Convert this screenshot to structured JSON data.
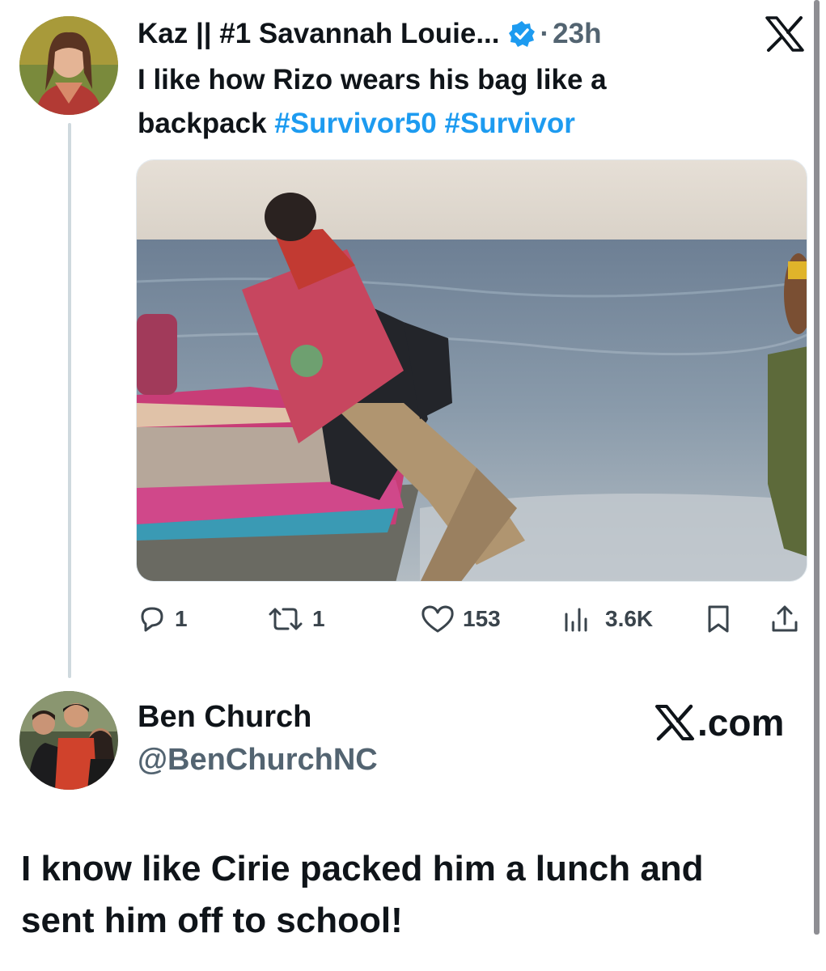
{
  "tweet": {
    "author_name": "Kaz || #1 Savannah Louie...",
    "separator": "·",
    "time": "23h",
    "text_lines": [
      "I like how Rizo wears his bag like a",
      "backpack"
    ],
    "hashtags": [
      "#Survivor50",
      "#Survivor"
    ],
    "verified_icon": "verified-badge-icon",
    "brand_icon": "x-logo-icon",
    "actions": {
      "replies": "1",
      "reposts": "1",
      "likes": "153",
      "views": "3.6K"
    }
  },
  "quote": {
    "name": "Ben Church",
    "handle": "@BenChurchNC",
    "brand": ".com",
    "text_lines": [
      "I know like Cirie packed him a lunch and",
      "sent him off to school!"
    ]
  },
  "colors": {
    "hashtag": "#1d9bf0",
    "verified": "#1d9bf0",
    "secondary_text": "#536471",
    "thread_line": "#cfd9de"
  }
}
